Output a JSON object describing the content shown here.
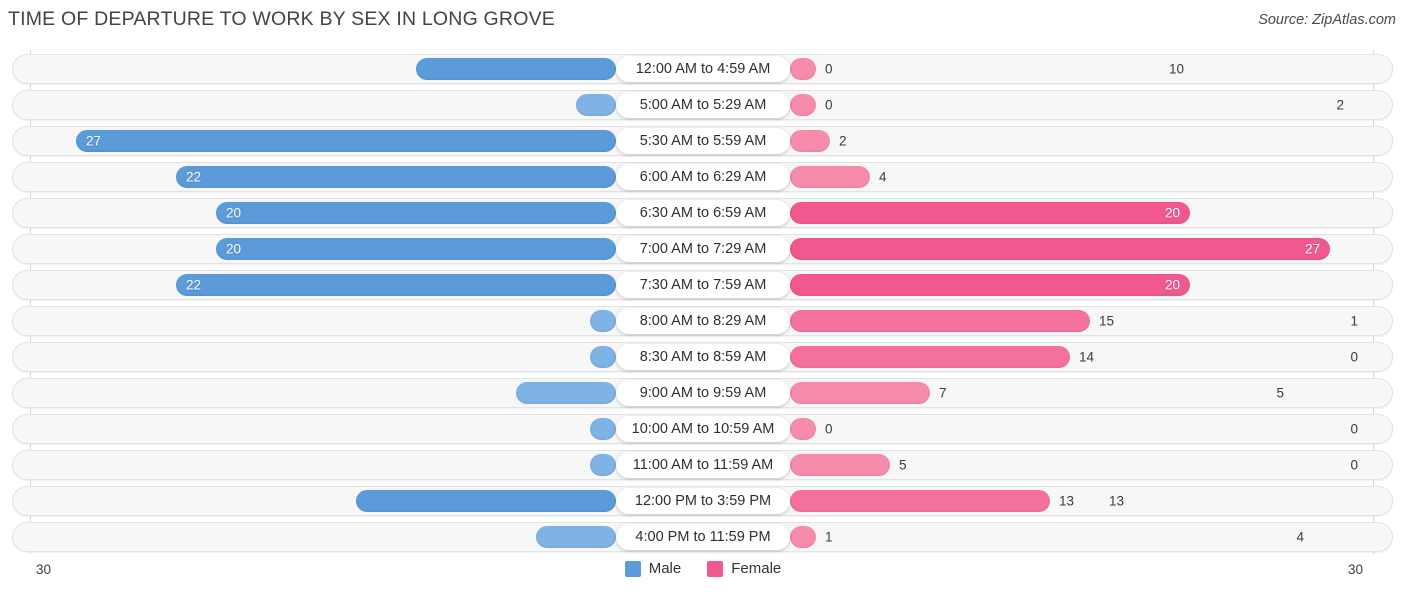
{
  "header": {
    "title": "TIME OF DEPARTURE TO WORK BY SEX IN LONG GROVE",
    "source": "Source: ZipAtlas.com"
  },
  "legend": {
    "male_label": "Male",
    "female_label": "Female",
    "male_color": "#5b9bd9",
    "female_color": "#f0588f"
  },
  "axis": {
    "left_tick": "30",
    "right_tick": "30",
    "max": 30
  },
  "chart_data": {
    "type": "bar",
    "orientation": "horizontal-diverging",
    "title": "TIME OF DEPARTURE TO WORK BY SEX IN LONG GROVE",
    "xlabel": "",
    "ylabel": "",
    "xlim": [
      30,
      30
    ],
    "grid": false,
    "legend_position": "bottom-center",
    "categories": [
      "12:00 AM to 4:59 AM",
      "5:00 AM to 5:29 AM",
      "5:30 AM to 5:59 AM",
      "6:00 AM to 6:29 AM",
      "6:30 AM to 6:59 AM",
      "7:00 AM to 7:29 AM",
      "7:30 AM to 7:59 AM",
      "8:00 AM to 8:29 AM",
      "8:30 AM to 8:59 AM",
      "9:00 AM to 9:59 AM",
      "10:00 AM to 10:59 AM",
      "11:00 AM to 11:59 AM",
      "12:00 PM to 3:59 PM",
      "4:00 PM to 11:59 PM"
    ],
    "series": [
      {
        "name": "Male",
        "color": "#5b9bd9",
        "values": [
          10,
          2,
          27,
          22,
          20,
          20,
          22,
          1,
          0,
          5,
          0,
          0,
          13,
          4
        ]
      },
      {
        "name": "Female",
        "color": "#f0588f",
        "values": [
          0,
          0,
          2,
          4,
          20,
          27,
          20,
          15,
          14,
          7,
          0,
          5,
          13,
          1
        ]
      }
    ]
  },
  "rows": [
    {
      "category": "12:00 AM to 4:59 AM",
      "male": "10",
      "female": "0"
    },
    {
      "category": "5:00 AM to 5:29 AM",
      "male": "2",
      "female": "0"
    },
    {
      "category": "5:30 AM to 5:59 AM",
      "male": "27",
      "female": "2"
    },
    {
      "category": "6:00 AM to 6:29 AM",
      "male": "22",
      "female": "4"
    },
    {
      "category": "6:30 AM to 6:59 AM",
      "male": "20",
      "female": "20"
    },
    {
      "category": "7:00 AM to 7:29 AM",
      "male": "20",
      "female": "27"
    },
    {
      "category": "7:30 AM to 7:59 AM",
      "male": "22",
      "female": "20"
    },
    {
      "category": "8:00 AM to 8:29 AM",
      "male": "1",
      "female": "15"
    },
    {
      "category": "8:30 AM to 8:59 AM",
      "male": "0",
      "female": "14"
    },
    {
      "category": "9:00 AM to 9:59 AM",
      "male": "5",
      "female": "7"
    },
    {
      "category": "10:00 AM to 10:59 AM",
      "male": "0",
      "female": "0"
    },
    {
      "category": "11:00 AM to 11:59 AM",
      "male": "0",
      "female": "5"
    },
    {
      "category": "12:00 PM to 3:59 PM",
      "male": "13",
      "female": "13"
    },
    {
      "category": "4:00 PM to 11:59 PM",
      "male": "4",
      "female": "1"
    }
  ]
}
